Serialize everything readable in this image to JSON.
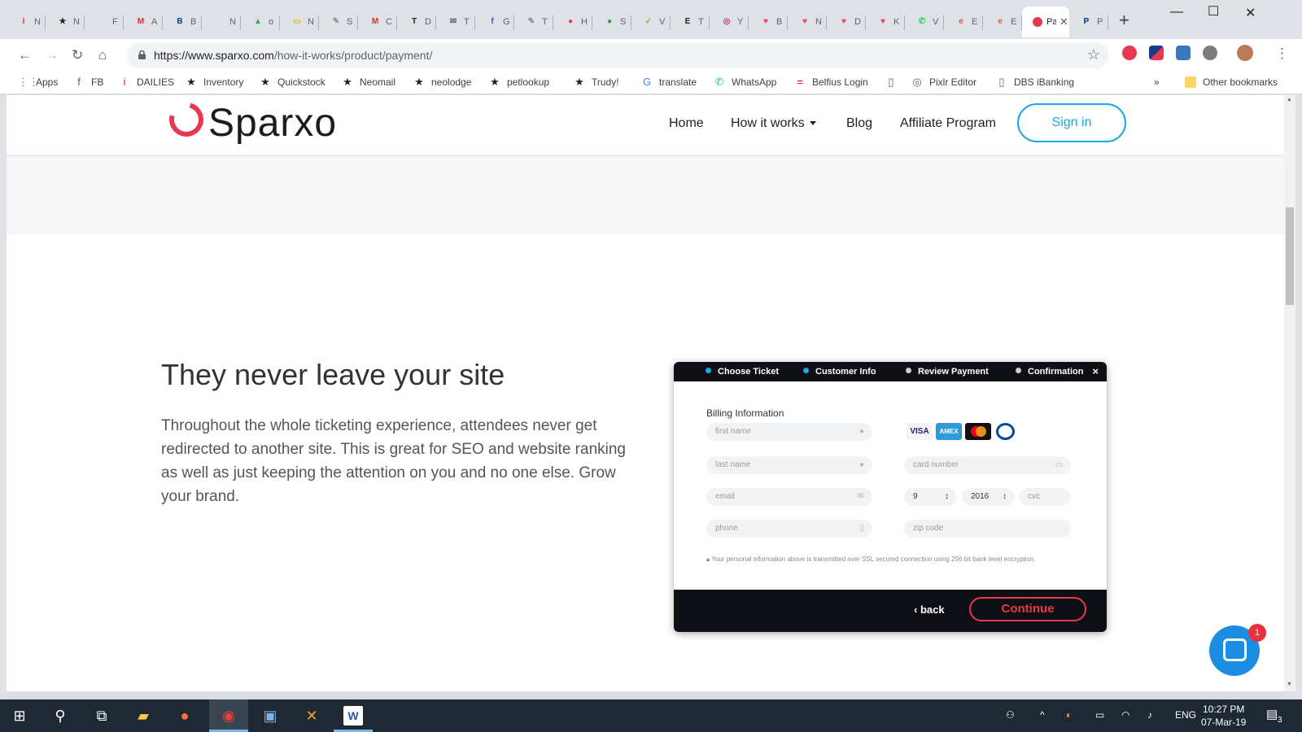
{
  "browser": {
    "tabs": [
      {
        "icon": "idn-icon",
        "title": "N",
        "color": "#c9302c",
        "glyph": "i"
      },
      {
        "icon": "star-bookmark-icon",
        "title": "N",
        "color": "#202124",
        "glyph": "★"
      },
      {
        "icon": "document-icon",
        "title": "F",
        "color": "#9aa0a6",
        "glyph": ""
      },
      {
        "icon": "gmail-icon",
        "title": "A",
        "color": "#d93025",
        "glyph": "M"
      },
      {
        "icon": "bpt-icon",
        "title": "B",
        "color": "#1b3a8c",
        "glyph": "B"
      },
      {
        "icon": "red-square-icon",
        "title": "N",
        "color": "#d32f2f",
        "glyph": ""
      },
      {
        "icon": "google-drive-icon",
        "title": "o",
        "color": "#34a853",
        "glyph": "▲"
      },
      {
        "icon": "slides-icon",
        "title": "N",
        "color": "#f4b400",
        "glyph": "▭"
      },
      {
        "icon": "scribble-icon",
        "title": "S",
        "color": "#8d8d8d",
        "glyph": "✎"
      },
      {
        "icon": "gmail-icon",
        "title": "C",
        "color": "#d93025",
        "glyph": "M"
      },
      {
        "icon": "t-logo-icon",
        "title": "D",
        "color": "#202124",
        "glyph": "T"
      },
      {
        "icon": "megaphone-icon",
        "title": "T",
        "color": "#5f6368",
        "glyph": "✉"
      },
      {
        "icon": "facebook-icon",
        "title": "G",
        "color": "#3b5998",
        "glyph": "f"
      },
      {
        "icon": "scribble-icon",
        "title": "T",
        "color": "#8d8d8d",
        "glyph": "✎"
      },
      {
        "icon": "avatar-red-icon",
        "title": "H",
        "color": "#e8453c",
        "glyph": "●"
      },
      {
        "icon": "green-circle-icon",
        "title": "S",
        "color": "#2ea043",
        "glyph": "●"
      },
      {
        "icon": "feather-icon",
        "title": "V",
        "color": "#7cb342",
        "glyph": "✓"
      },
      {
        "icon": "e-logo-icon",
        "title": "T",
        "color": "#202124",
        "glyph": "E"
      },
      {
        "icon": "instagram-icon",
        "title": "Y",
        "color": "#c13584",
        "glyph": "◎"
      },
      {
        "icon": "pocket-icon",
        "title": "B",
        "color": "#ef4056",
        "glyph": "♥"
      },
      {
        "icon": "pocket-icon",
        "title": "N",
        "color": "#ef4056",
        "glyph": "♥"
      },
      {
        "icon": "pocket-icon",
        "title": "D",
        "color": "#ef4056",
        "glyph": "♥"
      },
      {
        "icon": "pocket-icon",
        "title": "K",
        "color": "#ef4056",
        "glyph": "♥"
      },
      {
        "icon": "whatsapp-icon",
        "title": "V",
        "color": "#25d366",
        "glyph": "✆"
      },
      {
        "icon": "e-orange-icon",
        "title": "E",
        "color": "#f05537",
        "glyph": "e"
      },
      {
        "icon": "e-orange-icon",
        "title": "E",
        "color": "#f05537",
        "glyph": "e"
      },
      {
        "icon": "sparxo-tab-icon",
        "title": "Pa",
        "color": "#ffffff",
        "glyph": "",
        "active": true
      },
      {
        "icon": "paypal-icon",
        "title": "P",
        "color": "#003087",
        "glyph": "P"
      }
    ],
    "url_domain": "https://www.sparxo.com",
    "url_path": "/how-it-works/product/payment/",
    "bookmarks": [
      {
        "icon": "apps-grid-icon",
        "label": "Apps",
        "color": "#4285f4",
        "glyph": "⋮⋮"
      },
      {
        "icon": "facebook-icon",
        "label": "FB",
        "color": "#3b5998",
        "glyph": "f"
      },
      {
        "icon": "idn-icon",
        "label": "DAILIES",
        "color": "#c9302c",
        "glyph": "i"
      },
      {
        "icon": "star-bookmark-icon",
        "label": "Inventory",
        "color": "#202124",
        "glyph": "★"
      },
      {
        "icon": "star-bookmark-icon",
        "label": "Quickstock",
        "color": "#202124",
        "glyph": "★"
      },
      {
        "icon": "star-bookmark-icon",
        "label": "Neomail",
        "color": "#202124",
        "glyph": "★"
      },
      {
        "icon": "star-bookmark-icon",
        "label": "neolodge",
        "color": "#202124",
        "glyph": "★"
      },
      {
        "icon": "star-bookmark-icon",
        "label": "petlookup",
        "color": "#202124",
        "glyph": "★"
      },
      {
        "icon": "star-bookmark-icon",
        "label": "Trudy!",
        "color": "#202124",
        "glyph": "★"
      },
      {
        "icon": "google-translate-icon",
        "label": "translate",
        "color": "#4285f4",
        "glyph": "G"
      },
      {
        "icon": "whatsapp-icon",
        "label": "WhatsApp",
        "color": "#25d366",
        "glyph": "✆"
      },
      {
        "icon": "belfius-icon",
        "label": "Belfius Login",
        "color": "#c30045",
        "glyph": "="
      },
      {
        "icon": "document-icon",
        "label": "",
        "color": "#5f6368",
        "glyph": "▯"
      },
      {
        "icon": "pixlr-icon",
        "label": "Pixlr Editor",
        "color": "#5f6368",
        "glyph": "◎"
      },
      {
        "icon": "document-icon",
        "label": "DBS iBanking",
        "color": "#5f6368",
        "glyph": "▯"
      }
    ],
    "bookmarks_overflow": "»",
    "other_bookmarks": "Other bookmarks"
  },
  "site": {
    "logo": "Sparxo",
    "nav": {
      "home": "Home",
      "how_it_works": "How it works",
      "blog": "Blog",
      "affiliate": "Affiliate Program",
      "signin": "Sign in"
    },
    "headline": "They never leave your site",
    "paragraph": "Throughout the whole ticketing experience, attendees never get redirected to another site. This is great for SEO and website ranking as well as just keeping the attention on you and no one else. Grow your brand.",
    "widget": {
      "steps": [
        {
          "label": "Choose Ticket",
          "dot_color": "#1aa7e8"
        },
        {
          "label": "Customer Info",
          "dot_color": "#1aa7e8"
        },
        {
          "label": "Review Payment",
          "dot_color": "#cfcfcf"
        },
        {
          "label": "Confirmation",
          "dot_color": "#cfcfcf"
        }
      ],
      "close": "×",
      "billing_title": "Billing Information",
      "fields": {
        "first_name": "first name",
        "last_name": "last name",
        "email": "email",
        "phone": "phone",
        "card_number": "card number",
        "month": "9",
        "year": "2016",
        "cvc": "cvc",
        "zip": "zip code"
      },
      "cards": [
        "VISA",
        "AMEX",
        "mastercard",
        "diners"
      ],
      "note": "Your personal information above is transmitted over SSL secured connection using 256 bit bank level encryption.",
      "back": "back",
      "continue": "Continue"
    },
    "chat_badge": "1"
  },
  "taskbar": {
    "language": "ENG",
    "time": "10:27 PM",
    "date": "07-Mar-19",
    "notifications": "3"
  },
  "colors": {
    "accent_red": "#e8384f",
    "accent_blue": "#1aa7e8",
    "widget_dark": "#0d0f14"
  }
}
